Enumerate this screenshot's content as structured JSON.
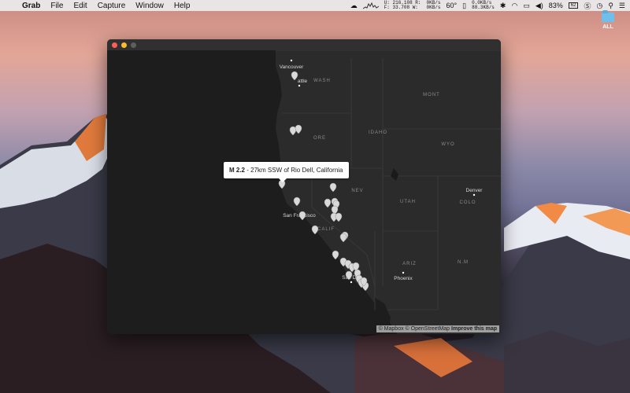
{
  "menubar": {
    "apple": "",
    "app_name": "Grab",
    "items": [
      "File",
      "Edit",
      "Capture",
      "Window",
      "Help"
    ],
    "stats1": {
      "u": "U: 216.108 R:",
      "f": "F: 33.708 W:"
    },
    "stats2": {
      "a": "0KB/s",
      "b": "0KB/s"
    },
    "temp": "60°",
    "net": {
      "a": "0.0KB/s",
      "b": "88.3KB/s"
    },
    "battery": "83%",
    "battery_badge": "62"
  },
  "desktop": {
    "folder_label": "ALL"
  },
  "map": {
    "labels": [
      {
        "name": "city-vancouver",
        "text": "Vancouver"
      },
      {
        "name": "city-seattle",
        "text": "attle"
      },
      {
        "name": "state-wash",
        "text": "WASH"
      },
      {
        "name": "state-mont",
        "text": "MONT"
      },
      {
        "name": "state-ore",
        "text": "ORE"
      },
      {
        "name": "state-idaho",
        "text": "IDAHO"
      },
      {
        "name": "state-wyo",
        "text": "WYO"
      },
      {
        "name": "state-nev",
        "text": "NEV"
      },
      {
        "name": "state-utah",
        "text": "UTAH"
      },
      {
        "name": "city-denver",
        "text": "Denver"
      },
      {
        "name": "state-colo",
        "text": "COLO"
      },
      {
        "name": "city-san-francisco",
        "text": "San Francisco"
      },
      {
        "name": "state-calif",
        "text": "CALIF"
      },
      {
        "name": "state-ariz",
        "text": "ARIZ"
      },
      {
        "name": "state-nm",
        "text": "N.M"
      },
      {
        "name": "city-phoenix",
        "text": "Phoenix"
      },
      {
        "name": "city-san-diego",
        "text": "San Di"
      }
    ],
    "popup": {
      "magnitude": "M 2.2",
      "sep": " - ",
      "place": "27km SSW of Rio Dell, California"
    },
    "attribution": {
      "mapbox": "© Mapbox",
      "osm": "© OpenStreetMap",
      "improve": "Improve this map"
    }
  }
}
